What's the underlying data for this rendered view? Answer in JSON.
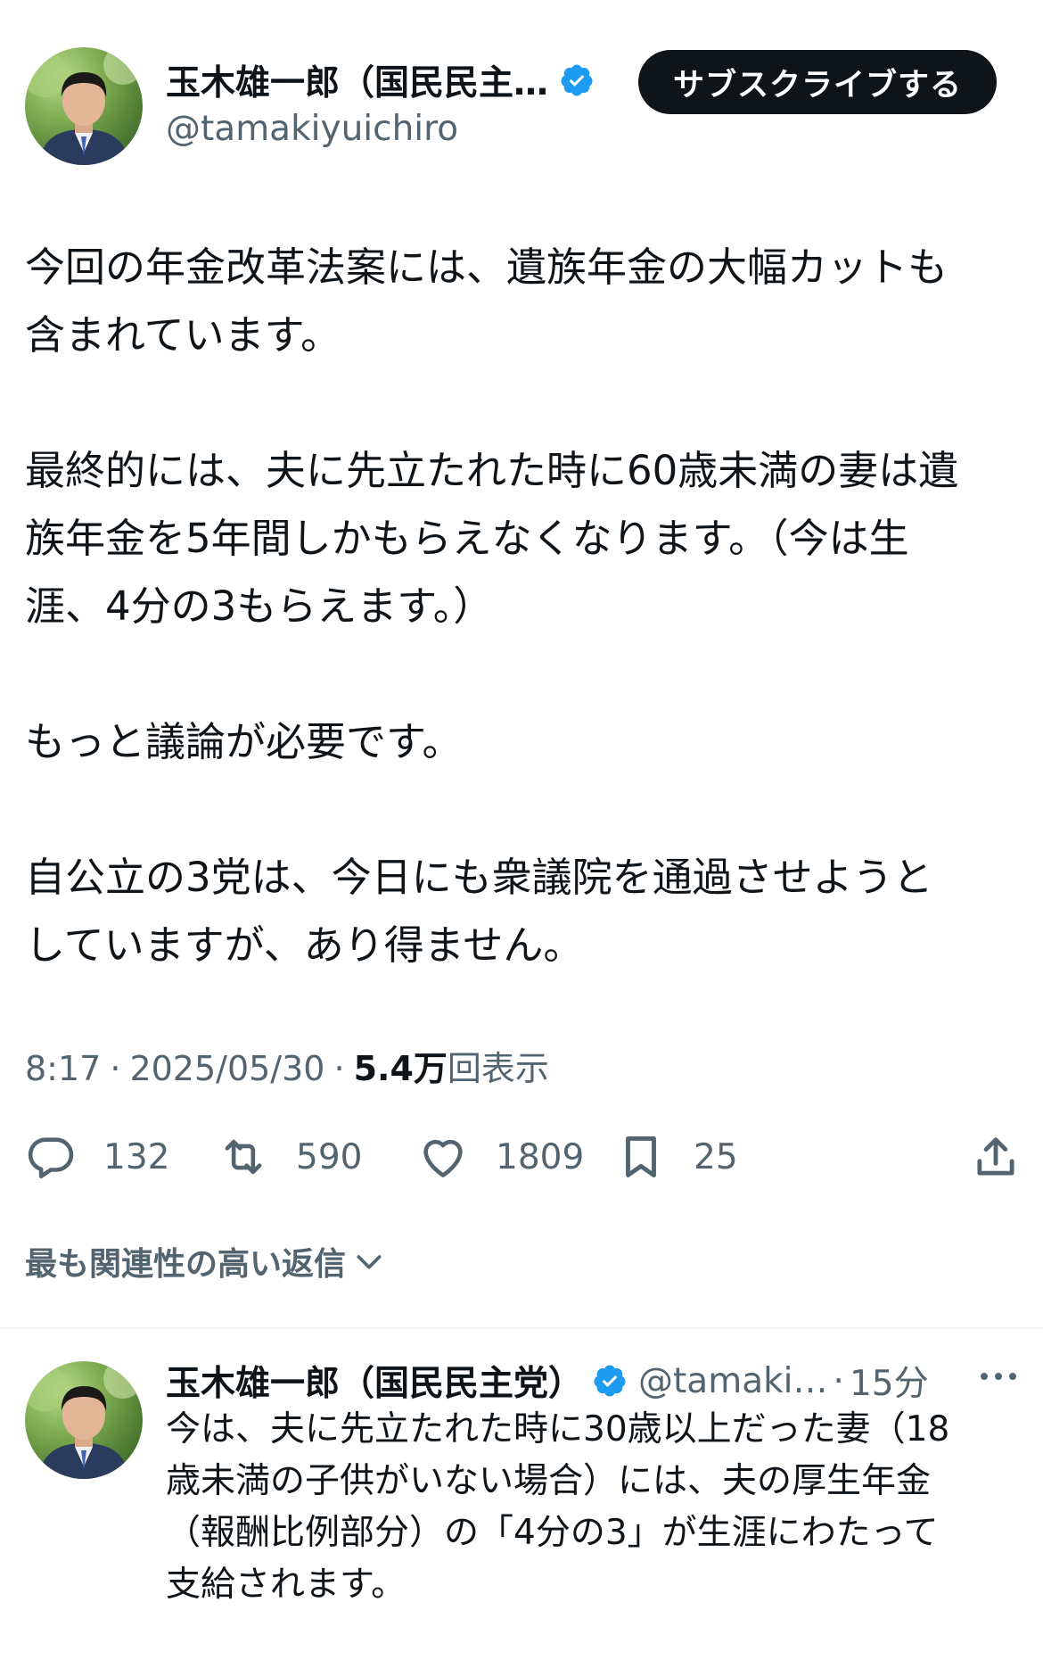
{
  "header": {
    "display_name": "玉木雄一郎（国民民主…",
    "handle": "@tamakiyuichiro",
    "subscribe_label": "サブスクライブする"
  },
  "tweet": {
    "paragraphs": [
      [
        "今回の年金改革法案には、遺族年金の大幅カットも",
        "含まれています。"
      ],
      [
        "最終的には、夫に先立たれた時に60歳未満の妻は遺",
        "族年金を5年間しかもらえなくなります。（今は生",
        "涯、4分の3もらえます。）"
      ],
      [
        "もっと議論が必要です。"
      ],
      [
        "自公立の3党は、今日にも衆議院を通過させようと",
        "していますが、あり得ません。"
      ]
    ]
  },
  "meta": {
    "time": "8:17",
    "separator": "·",
    "date": "2025/05/30",
    "views_count": "5.4万",
    "views_label": "回表示"
  },
  "actions": {
    "reply_count": "132",
    "retweet_count": "590",
    "like_count": "1809",
    "bookmark_count": "25"
  },
  "replies_sort_label": "最も関連性の高い返信",
  "reply": {
    "display_name": "玉木雄一郎（国民民主党）",
    "handle": "@tamaki…",
    "dot": "·",
    "time": "15分",
    "lines": [
      "今は、夫に先立たれた時に30歳以上だった妻（18",
      "歳未満の子供がいない場合）には、夫の厚生年金",
      "（報酬比例部分）の「4分の3」が生涯にわたって",
      "支給されます。"
    ]
  },
  "colors": {
    "text_primary": "#0f1419",
    "text_secondary": "#536471",
    "verified_blue": "#1d9bf0",
    "button_bg": "#0f1419",
    "divider": "#eff3f4"
  },
  "icons": [
    "verified-badge-icon",
    "reply-icon",
    "retweet-icon",
    "like-icon",
    "bookmark-icon",
    "share-icon",
    "chevron-down-icon",
    "more-icon"
  ]
}
